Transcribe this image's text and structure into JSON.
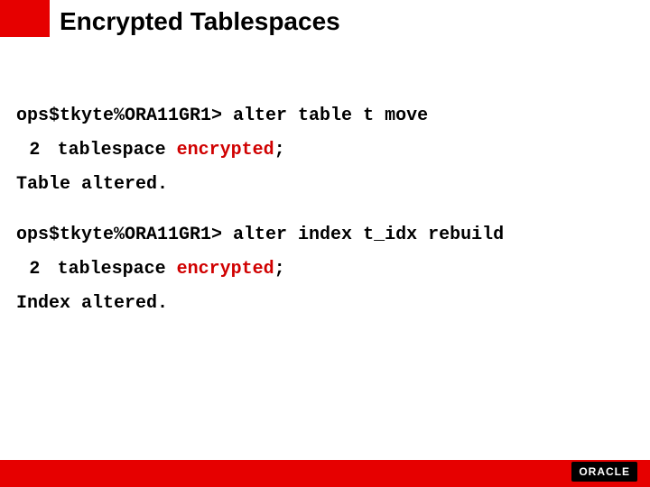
{
  "title": "Encrypted Tablespaces",
  "code": {
    "line1_prefix": "ops$tkyte%ORA11GR1> alter table t move",
    "line2_num": "2",
    "line2_text_before": "  tablespace ",
    "line2_kw": "encrypted",
    "line2_text_after": ";",
    "line3": "Table altered.",
    "line4_prefix": "ops$tkyte%ORA11GR1> alter index t_idx rebuild",
    "line5_num": "2",
    "line5_text_before": "  tablespace ",
    "line5_kw": "encrypted",
    "line5_text_after": ";",
    "line6": "Index altered."
  },
  "footer": {
    "logo": "ORACLE"
  }
}
